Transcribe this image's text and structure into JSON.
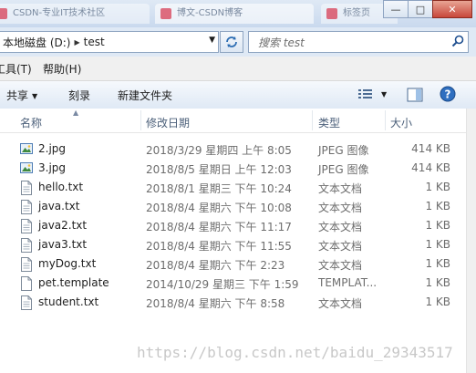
{
  "tabs": [
    {
      "label": "CSDN-专业IT技术社区"
    },
    {
      "label": "博文-CSDN博客"
    },
    {
      "label": "标签页"
    }
  ],
  "window": {
    "minimize": "—",
    "maximize": "□",
    "close": "✕"
  },
  "address": {
    "drive": "本地磁盘 (D:)",
    "folder": "test"
  },
  "search": {
    "placeholder": "搜索 test"
  },
  "menu": {
    "tools": "工具(T)",
    "help": "帮助(H)"
  },
  "toolbar": {
    "share": "共享",
    "burn": "刻录",
    "new_folder": "新建文件夹"
  },
  "columns": {
    "name": "名称",
    "date": "修改日期",
    "type": "类型",
    "size": "大小"
  },
  "files": [
    {
      "name": "2.jpg",
      "date": "2018/3/29 星期四 上午 8:05",
      "type": "JPEG 图像",
      "size": "414 KB",
      "icon": "image-file-icon"
    },
    {
      "name": "3.jpg",
      "date": "2018/8/5 星期日 上午 12:03",
      "type": "JPEG 图像",
      "size": "414 KB",
      "icon": "image-file-icon"
    },
    {
      "name": "hello.txt",
      "date": "2018/8/1 星期三 下午 10:24",
      "type": "文本文档",
      "size": "1 KB",
      "icon": "text-file-icon"
    },
    {
      "name": "java.txt",
      "date": "2018/8/4 星期六 下午 10:08",
      "type": "文本文档",
      "size": "1 KB",
      "icon": "text-file-icon"
    },
    {
      "name": "java2.txt",
      "date": "2018/8/4 星期六 下午 11:17",
      "type": "文本文档",
      "size": "1 KB",
      "icon": "text-file-icon"
    },
    {
      "name": "java3.txt",
      "date": "2018/8/4 星期六 下午 11:55",
      "type": "文本文档",
      "size": "1 KB",
      "icon": "text-file-icon"
    },
    {
      "name": "myDog.txt",
      "date": "2018/8/4 星期六 下午 2:23",
      "type": "文本文档",
      "size": "1 KB",
      "icon": "text-file-icon"
    },
    {
      "name": "pet.template",
      "date": "2014/10/29 星期三 下午 1:59",
      "type": "TEMPLAT...",
      "size": "1 KB",
      "icon": "blank-file-icon"
    },
    {
      "name": "student.txt",
      "date": "2018/8/4 星期六 下午 8:58",
      "type": "文本文档",
      "size": "1 KB",
      "icon": "text-file-icon"
    }
  ],
  "watermark": "https://blog.csdn.net/baidu_29343517"
}
